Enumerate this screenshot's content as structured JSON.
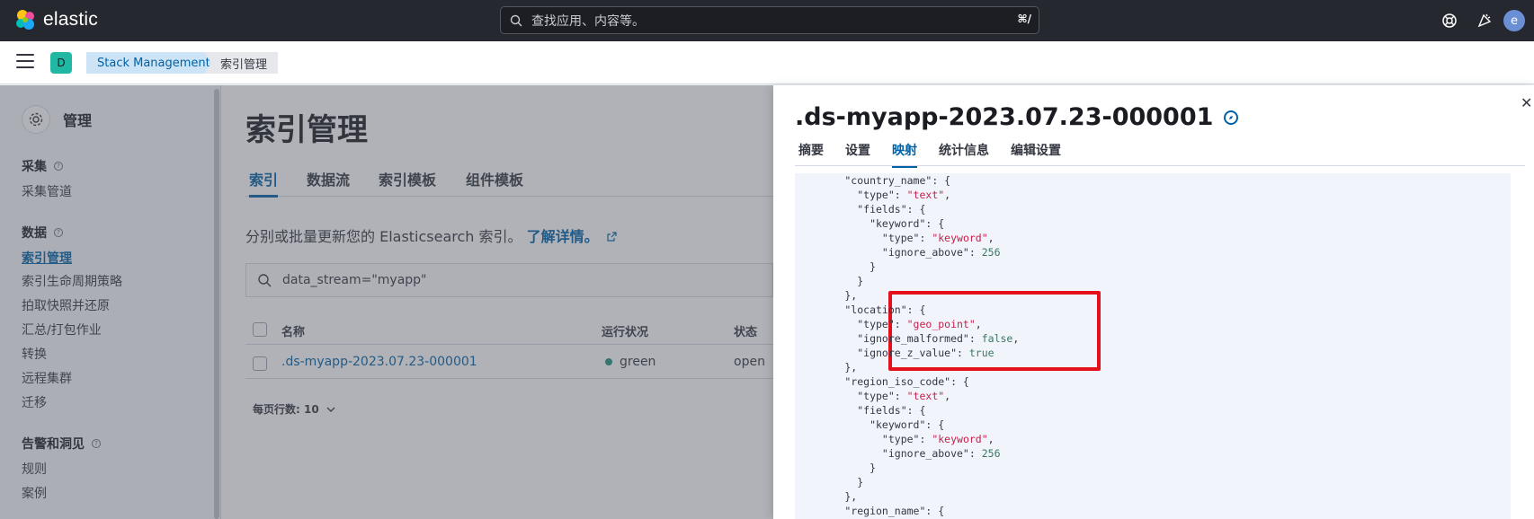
{
  "header": {
    "logo_text": "elastic",
    "search_placeholder": "查找应用、内容等。",
    "search_shortcut": "⌘/",
    "user_initial": "e",
    "icons": [
      "help-lifebuoy-icon",
      "newsfeed-rocket-icon"
    ]
  },
  "subbar": {
    "space_initial": "D",
    "breadcrumbs": [
      "Stack Management",
      "索引管理"
    ]
  },
  "sidebar": {
    "title": "管理",
    "groups": [
      {
        "label": "采集",
        "items": [
          "采集管道"
        ]
      },
      {
        "label": "数据",
        "items": [
          "索引管理",
          "索引生命周期策略",
          "拍取快照并还原",
          "汇总/打包作业",
          "转换",
          "远程集群",
          "迁移"
        ]
      },
      {
        "label": "告警和洞见",
        "items": [
          "规则",
          "案例"
        ]
      }
    ],
    "active_item": "索引管理"
  },
  "main": {
    "title": "索引管理",
    "tabs": [
      "索引",
      "数据流",
      "索引模板",
      "组件模板"
    ],
    "selected_tab": "索引",
    "description": "分别或批量更新您的 Elasticsearch 索引。",
    "learn_more": "了解详情。",
    "filter_value": "data_stream=\"myapp\"",
    "table": {
      "headers": [
        "名称",
        "运行状况",
        "状态"
      ],
      "rows": [
        {
          "name": ".ds-myapp-2023.07.23-000001",
          "health": "green",
          "status": "open"
        }
      ]
    },
    "rows_per_page": "每页行数: 10"
  },
  "flyout": {
    "title": ".ds-myapp-2023.07.23-000001",
    "tabs": [
      "摘要",
      "设置",
      "映射",
      "统计信息",
      "编辑设置"
    ],
    "selected_tab": "映射",
    "code_lines": [
      "        \"country_name\": {",
      "          \"type\": \"text\",",
      "          \"fields\": {",
      "            \"keyword\": {",
      "              \"type\": \"keyword\",",
      "              \"ignore_above\": 256",
      "            }",
      "          }",
      "        },",
      "        \"location\": {",
      "          \"type\": \"geo_point\",",
      "          \"ignore_malformed\": false,",
      "          \"ignore_z_value\": true",
      "        },",
      "        \"region_iso_code\": {",
      "          \"type\": \"text\",",
      "          \"fields\": {",
      "            \"keyword\": {",
      "              \"type\": \"keyword\",",
      "              \"ignore_above\": 256",
      "            }",
      "          }",
      "        },",
      "        \"region_name\": {"
    ],
    "highlighted_key": "location"
  },
  "colors": {
    "accent": "#0061a6",
    "header_bg": "#25282f",
    "highlight_border": "#e4111d",
    "string_value": "#c61e4a",
    "number_value": "#387765"
  }
}
